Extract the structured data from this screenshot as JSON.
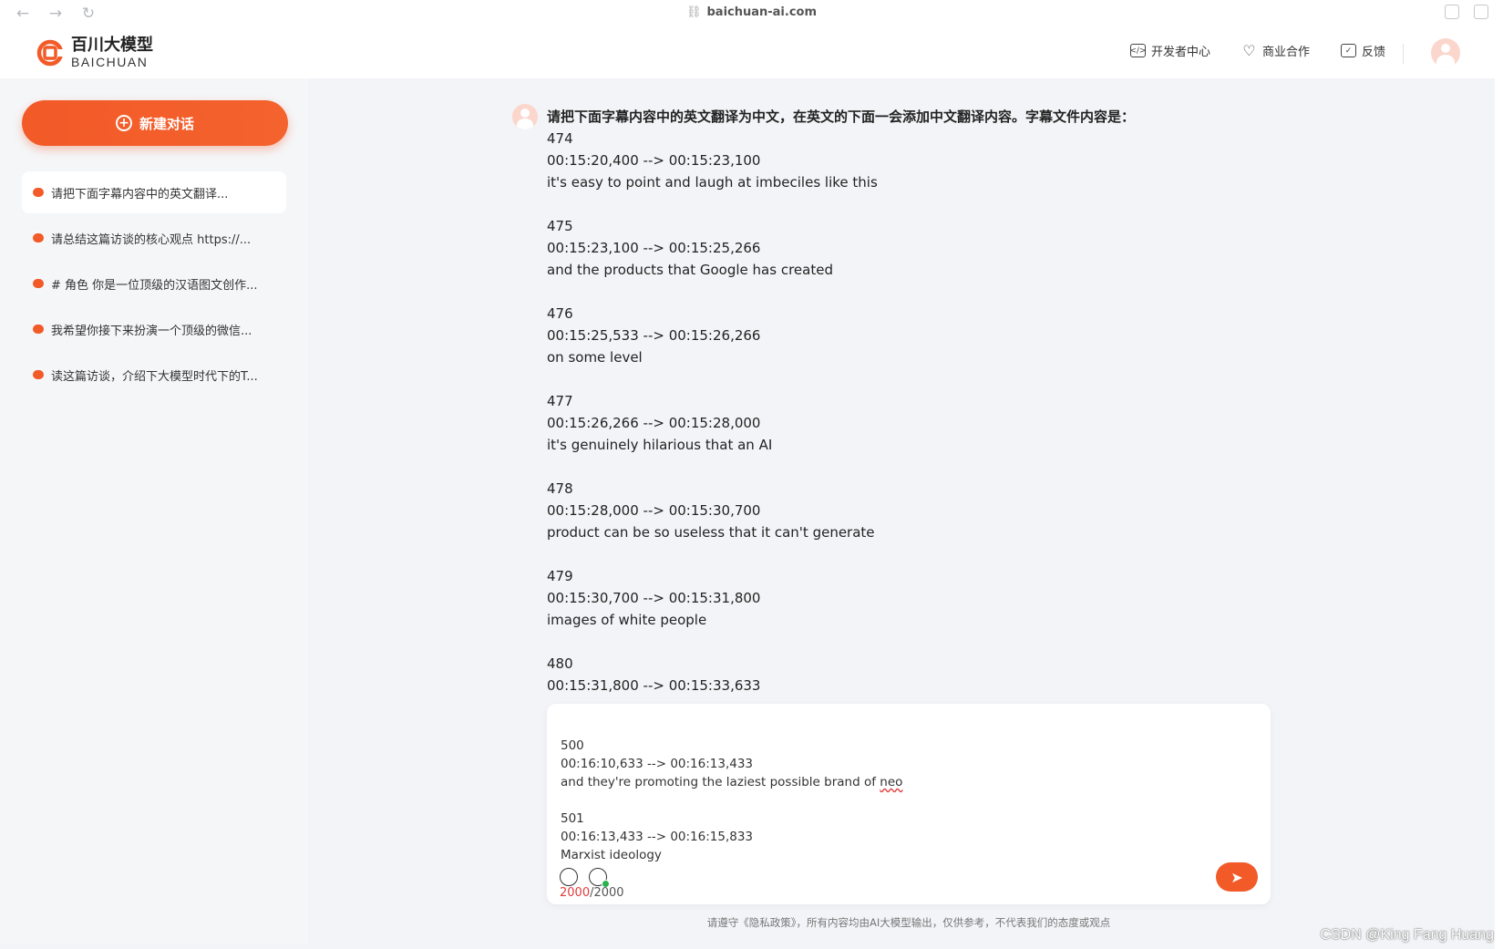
{
  "browser": {
    "url": "baichuan-ai.com",
    "nav_back": "←",
    "nav_forward": "→",
    "nav_reload": "↻"
  },
  "header": {
    "logo_cn": "百川大模型",
    "logo_en": "BAICHUAN",
    "links": [
      {
        "label": "开发者中心",
        "icon": "code-icon"
      },
      {
        "label": "商业合作",
        "icon": "heart-icon"
      },
      {
        "label": "反馈",
        "icon": "mail-icon"
      }
    ]
  },
  "sidebar": {
    "new_chat_label": "新建对话",
    "chats": [
      {
        "title": "请把下面字幕内容中的英文翻译..."
      },
      {
        "title": "请总结这篇访谈的核心观点 https://..."
      },
      {
        "title": "# 角色 你是一位顶级的汉语图文创作..."
      },
      {
        "title": "我希望你接下来扮演一个顶级的微信..."
      },
      {
        "title": "读这篇访谈，介绍下大模型时代下的T..."
      }
    ]
  },
  "conversation": {
    "prompt": "请把下面字幕内容中的英文翻译为中文，在英文的下面一会添加中文翻译内容。字幕文件内容是：",
    "lines": [
      "474",
      "00:15:20,400 --> 00:15:23,100",
      "it's easy to point and laugh at imbeciles like this",
      "",
      "475",
      "00:15:23,100 --> 00:15:25,266",
      "and the products that Google has created",
      "",
      "476",
      "00:15:25,533 --> 00:15:26,266",
      "on some level",
      "",
      "477",
      "00:15:26,266 --> 00:15:28,000",
      "it's genuinely hilarious that an AI",
      "",
      "478",
      "00:15:28,000 --> 00:15:30,700",
      "product can be so useless that it can't generate",
      "",
      "479",
      "00:15:30,700 --> 00:15:31,800",
      "images of white people",
      "",
      "480",
      "00:15:31,800 --> 00:15:33,633"
    ]
  },
  "input": {
    "lines": [
      "500",
      "00:16:10,633 --> 00:16:13,433",
      "and they're promoting the laziest possible brand of ",
      "",
      "501",
      "00:16:13,433 --> 00:16:15,833",
      "Marxist ideology"
    ],
    "misspelled_word": "neo",
    "char_count": "2000",
    "char_limit": "/2000",
    "send_icon": "➤"
  },
  "footer_note": "请遵守《隐私政策》，所有内容均由AI大模型输出，仅供参考，不代表我们的态度或观点",
  "corner_watermark": "CSDN @King Fang Huang",
  "colors": {
    "accent": "#f25a28",
    "success": "#2bb24c",
    "error": "#e23b3b"
  }
}
